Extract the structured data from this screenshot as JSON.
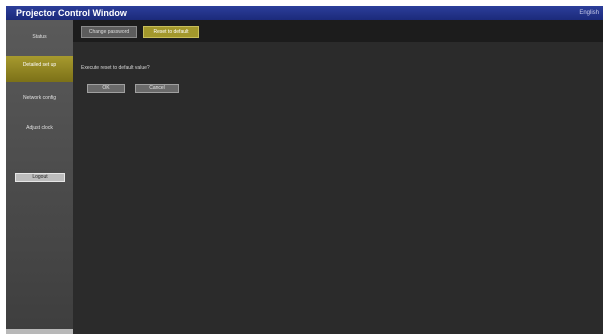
{
  "window": {
    "title": "Projector Control Window",
    "language": "English"
  },
  "sidebar": {
    "items": [
      {
        "label": "Status"
      },
      {
        "label": "Detailed set up"
      },
      {
        "label": "Network config"
      },
      {
        "label": "Adjust clock"
      }
    ],
    "logout_label": "Logout"
  },
  "tabs": [
    {
      "label": "Change password"
    },
    {
      "label": "Reset to default"
    }
  ],
  "main": {
    "message": "Execute reset to default value?",
    "ok_label": "OK",
    "cancel_label": "Cancel"
  },
  "colors": {
    "title_bar": "#1b2a7a",
    "active_accent": "#a3982c",
    "background": "#2b2b2b"
  }
}
